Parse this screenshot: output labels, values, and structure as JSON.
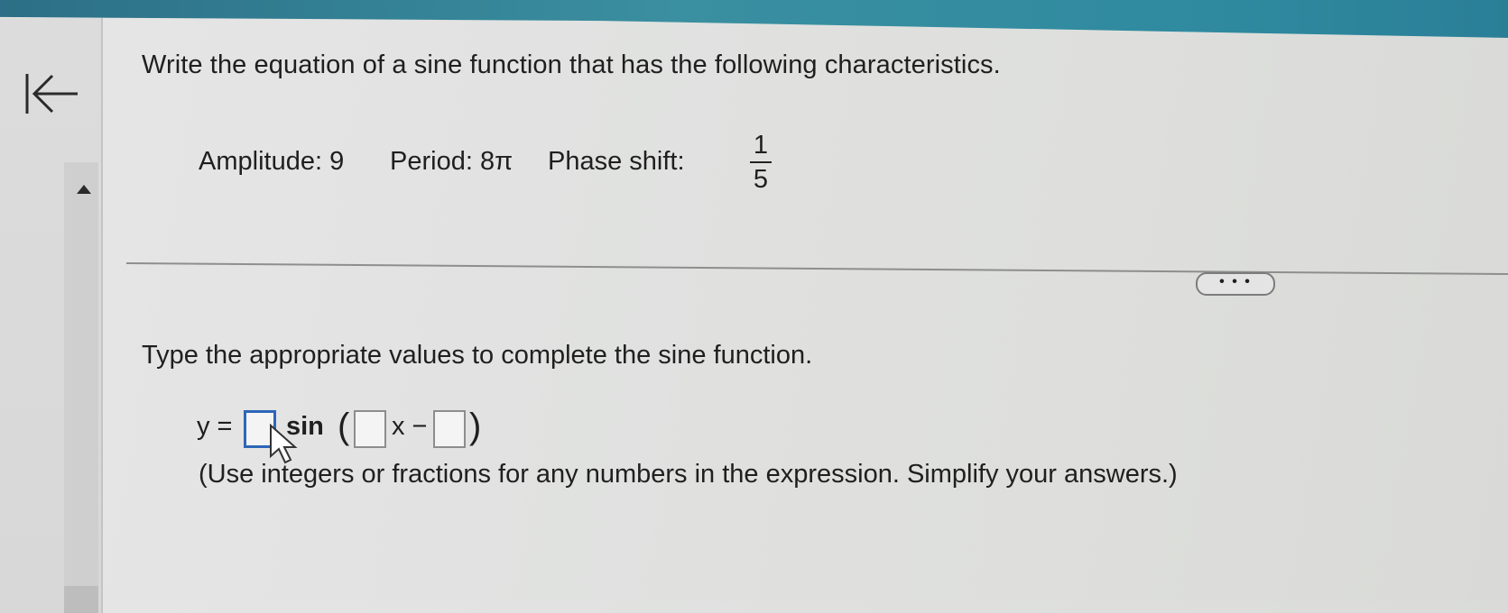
{
  "question": {
    "prompt": "Write the equation of a sine function that has the following characteristics.",
    "amplitude_label": "Amplitude: 9",
    "period_label": "Period: 8π",
    "phase_shift_label": "Phase shift:",
    "phase_shift_numerator": "1",
    "phase_shift_denominator": "5"
  },
  "toolbar": {
    "more_label": "• • •"
  },
  "answer": {
    "instruction": "Type the appropriate values to complete the sine function.",
    "eq_prefix": "y =",
    "eq_sin": "sin",
    "eq_open_paren": "(",
    "eq_x_minus": "x −",
    "eq_close_paren": ")",
    "box1_value": "",
    "box2_value": "",
    "box3_value": "",
    "hint": "(Use integers or fractions for any numbers in the expression. Simplify your answers.)"
  },
  "colors": {
    "top_bar": "#2f8aa0",
    "active_box_border": "#2d66b7"
  },
  "icons": {
    "collapse": "collapse-left-icon",
    "scroll_up": "scroll-up-icon",
    "pointer": "mouse-pointer-icon"
  }
}
